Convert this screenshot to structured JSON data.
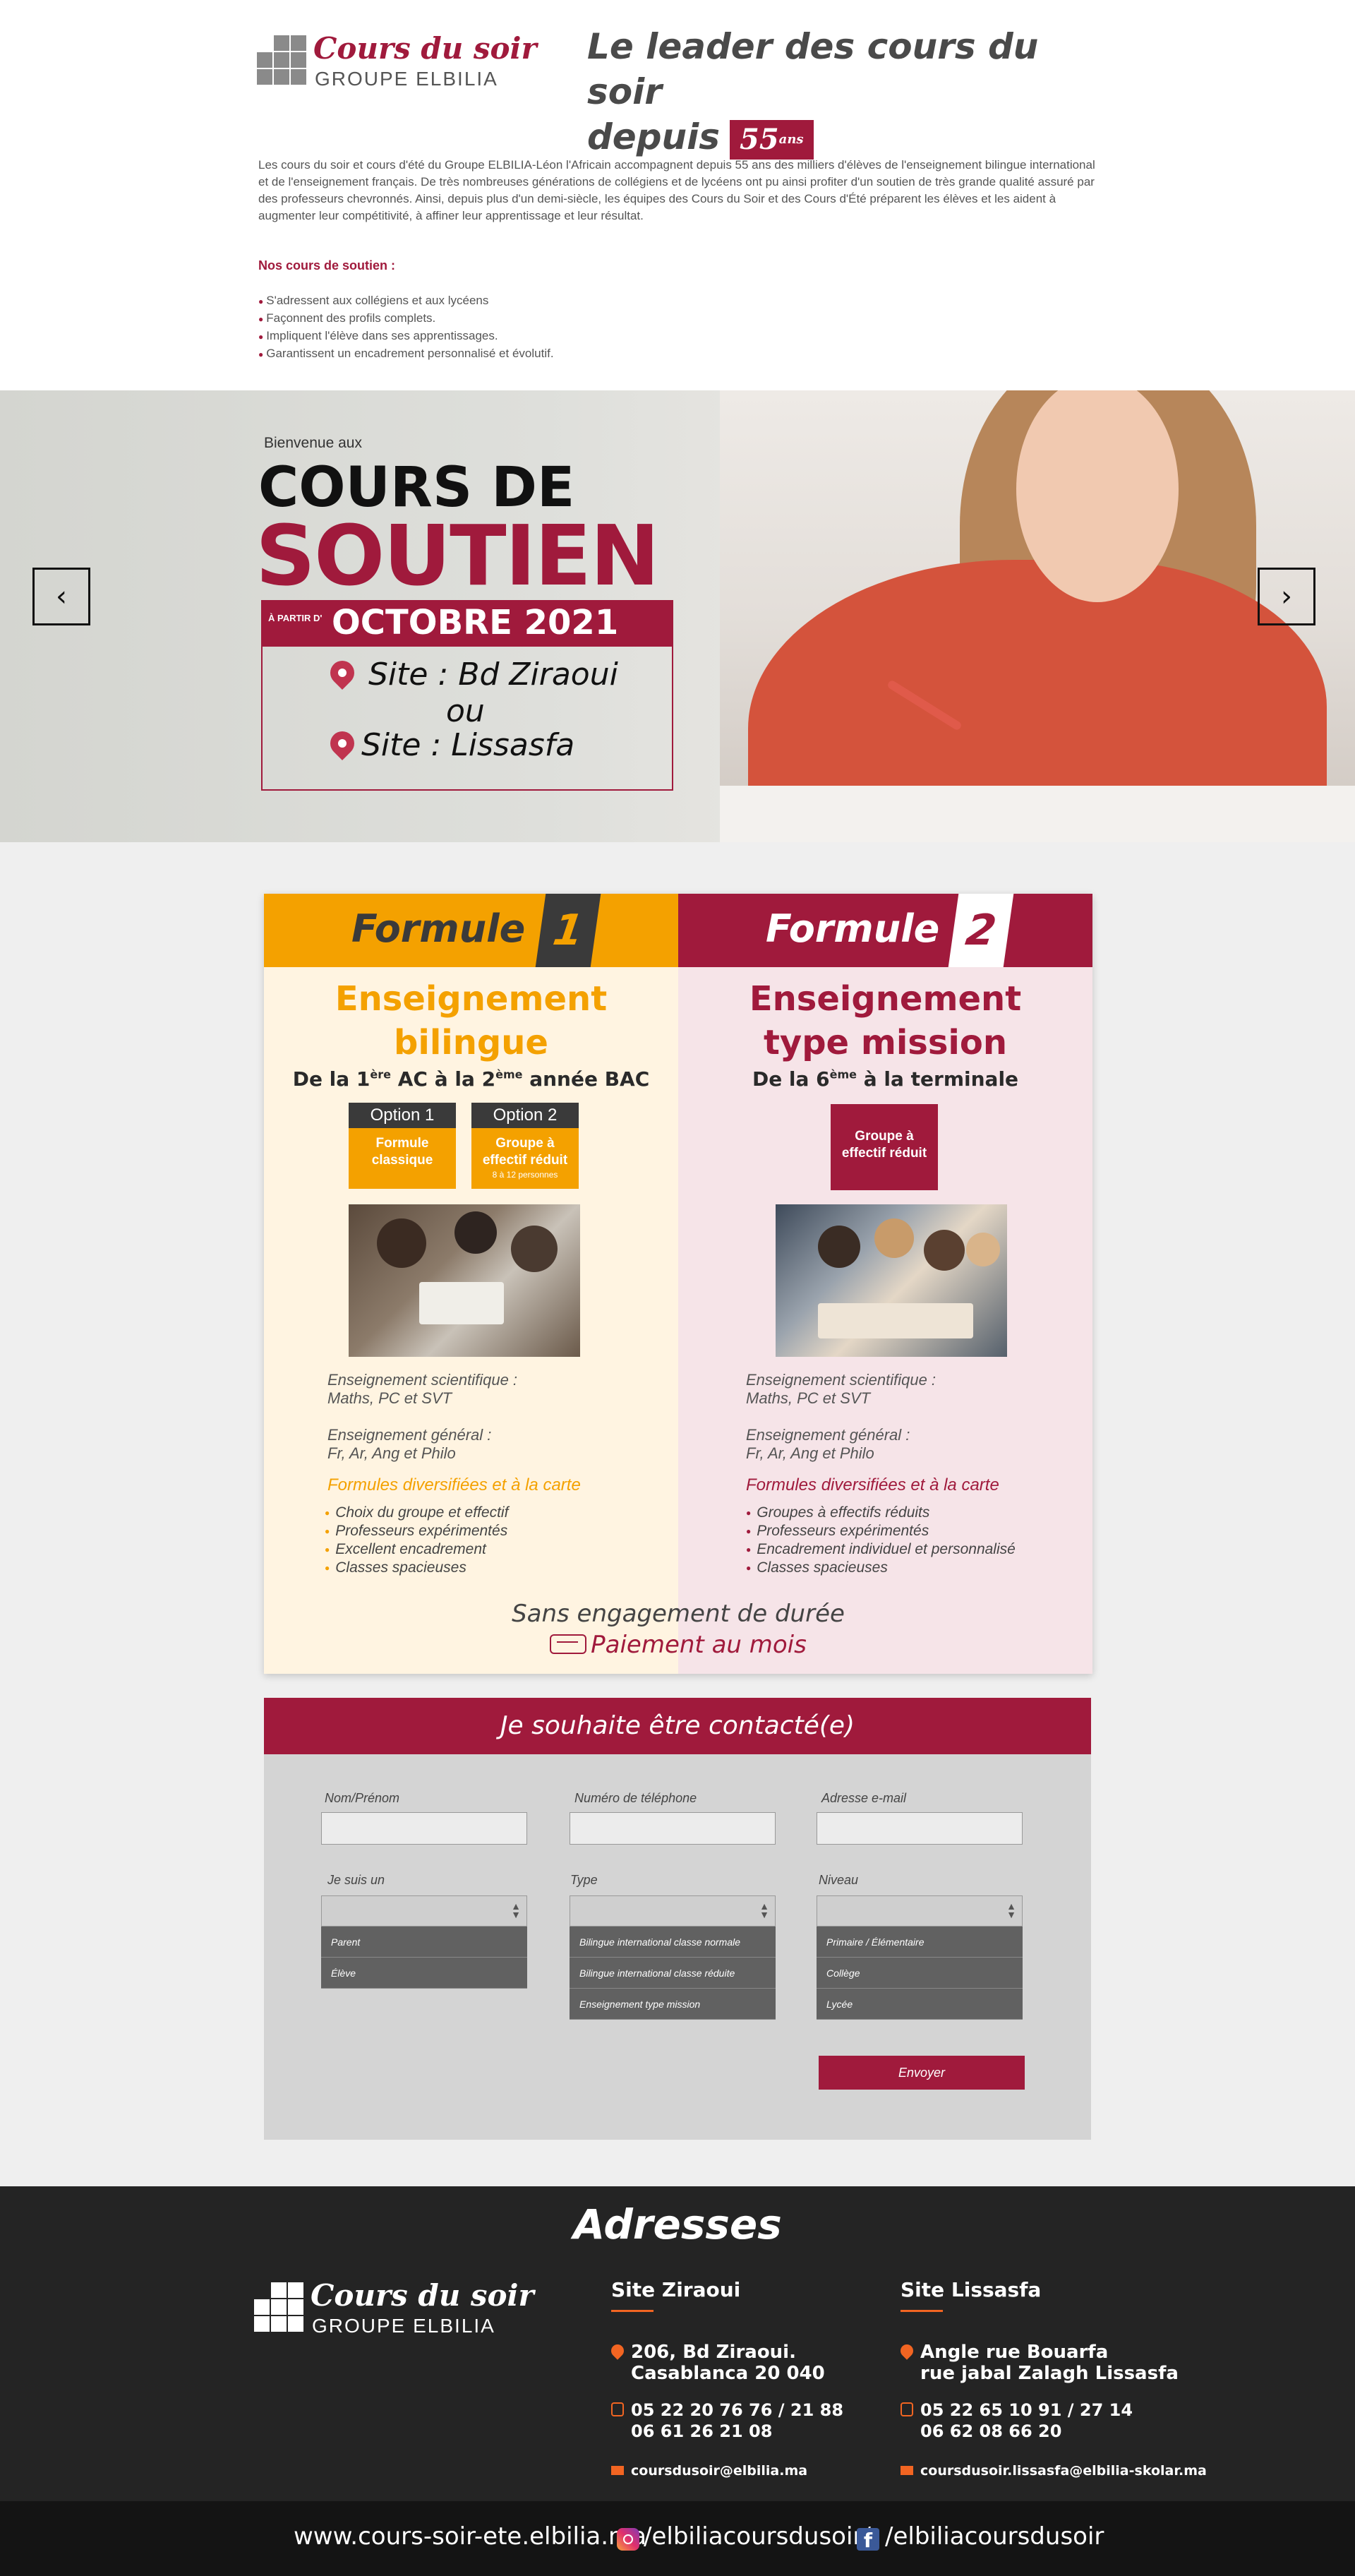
{
  "header": {
    "logo_title": "Cours du soir",
    "logo_subtitle": "GROUPE ELBILIA",
    "headline_line1": "Le leader des cours du soir",
    "headline_line2": "depuis",
    "badge_number": "55",
    "badge_unit": "ans"
  },
  "intro": {
    "paragraph": "Les cours du soir et cours d'été du Groupe ELBILIA-Léon l'Africain accompagnent depuis 55 ans des milliers d'élèves de l'enseignement bilingue international et de l'enseignement français. De très nombreuses générations de collégiens et de lycéens ont pu ainsi profiter d'un soutien de très grande qualité assuré par des professeurs chevronnés. Ainsi, depuis plus d'un demi-siècle, les équipes des Cours du Soir et des Cours d'Été préparent les élèves et les aident à augmenter leur compétitivité, à affiner leur apprentissage et leur résultat.",
    "list_title": "Nos cours de soutien :",
    "list": [
      "S'adressent aux collégiens et aux lycéens",
      "Façonnent des profils complets.",
      "Impliquent l'élève dans ses apprentissages.",
      "Garantissent un encadrement personnalisé et évolutif."
    ]
  },
  "hero": {
    "welcome": "Bienvenue aux",
    "title_line1": "COURS DE",
    "title_line2": "SOUTIEN",
    "date_prefix": "À PARTIR D'",
    "date_month": "OCTOBRE 2021",
    "site1": "Site : Bd Ziraoui",
    "or": "ou",
    "site2": "Site : Lissasfa",
    "prev_arrow": "‹",
    "next_arrow": "›"
  },
  "formules": {
    "left": {
      "head_word": "Formule",
      "head_num": "1",
      "title_line1": "Enseignement",
      "title_line2": "bilingue",
      "sub_a": "De la 1",
      "sub_sup1": "ère",
      "sub_b": " AC à la 2",
      "sub_sup2": "ème",
      "sub_c": " année BAC",
      "option1_head": "Option 1",
      "option1_body_l1": "Formule",
      "option1_body_l2": "classique",
      "option2_head": "Option 2",
      "option2_body_l1": "Groupe à",
      "option2_body_l2": "effectif réduit",
      "option2_note": "8 à 12 personnes",
      "sci_l1": "Enseignement scientifique :",
      "sci_l2": "Maths, PC et SVT",
      "gen_l1": "Enseignement général :",
      "gen_l2": "Fr, Ar, Ang et Philo",
      "accent": "Formules diversifiées et à la carte",
      "list": [
        "Choix du groupe et effectif",
        "Professeurs expérimentés",
        "Excellent encadrement",
        "Classes spacieuses"
      ]
    },
    "right": {
      "head_word": "Formule",
      "head_num": "2",
      "title_line1": "Enseignement",
      "title_line2": "type mission",
      "sub_a": "De la 6",
      "sub_sup1": "ème",
      "sub_b": " à la terminale",
      "option_l1": "Groupe à",
      "option_l2": "effectif réduit",
      "sci_l1": "Enseignement scientifique :",
      "sci_l2": "Maths, PC et SVT",
      "gen_l1": "Enseignement général :",
      "gen_l2": "Fr, Ar, Ang et Philo",
      "accent": "Formules diversifiées et à la carte",
      "list": [
        "Groupes à effectifs réduits",
        "Professeurs expérimentés",
        "Encadrement individuel et personnalisé",
        "Classes spacieuses"
      ]
    },
    "engagement": "Sans engagement de durée",
    "paiement": "Paiement au mois"
  },
  "contact": {
    "title": "Je souhaite être contacté(e)",
    "name_label": "Nom/Prénom",
    "phone_label": "Numéro de téléphone",
    "email_label": "Adresse e-mail",
    "role_label": "Je suis un",
    "role_options": [
      "Parent",
      "Élève"
    ],
    "type_label": "Type",
    "type_options": [
      "Bilingue international classe normale",
      "Bilingue international classe réduite",
      "Enseignement type mission"
    ],
    "level_label": "Niveau",
    "level_options": [
      "Primaire / Élémentaire",
      "Collège",
      "Lycée"
    ],
    "submit": "Envoyer"
  },
  "addresses": {
    "title": "Adresses",
    "ziraoui": {
      "name": "Site Ziraoui",
      "addr_l1": "206, Bd Ziraoui.",
      "addr_l2": "Casablanca 20 040",
      "phone_l1": "05 22 20 76 76 / 21 88",
      "phone_l2": "06 61 26 21 08",
      "email": "coursdusoir@elbilia.ma"
    },
    "lissasfa": {
      "name": "Site Lissasfa",
      "addr_l1": "Angle rue Bouarfa",
      "addr_l2": "rue jabal Zalagh Lissasfa",
      "phone_l1": "05 22 65 10 91 / 27 14",
      "phone_l2": "06 62 08 66 20",
      "email": "coursdusoir.lissasfa@elbilia-skolar.ma"
    }
  },
  "footer": {
    "website": "www.cours-soir-ete.elbilia.ma",
    "instagram": "/elbiliacoursdusoir/",
    "facebook": "/elbiliacoursdusoir"
  },
  "colors": {
    "brand": "#a01a3c",
    "orange": "#f4a100",
    "accent_icon": "#f26522"
  },
  "icons": [
    "logo-squares-icon",
    "map-pin-icon",
    "chevron-left-icon",
    "chevron-right-icon",
    "hand-card-icon",
    "select-caret-icon",
    "phone-icon",
    "mail-icon",
    "instagram-icon",
    "facebook-icon"
  ]
}
